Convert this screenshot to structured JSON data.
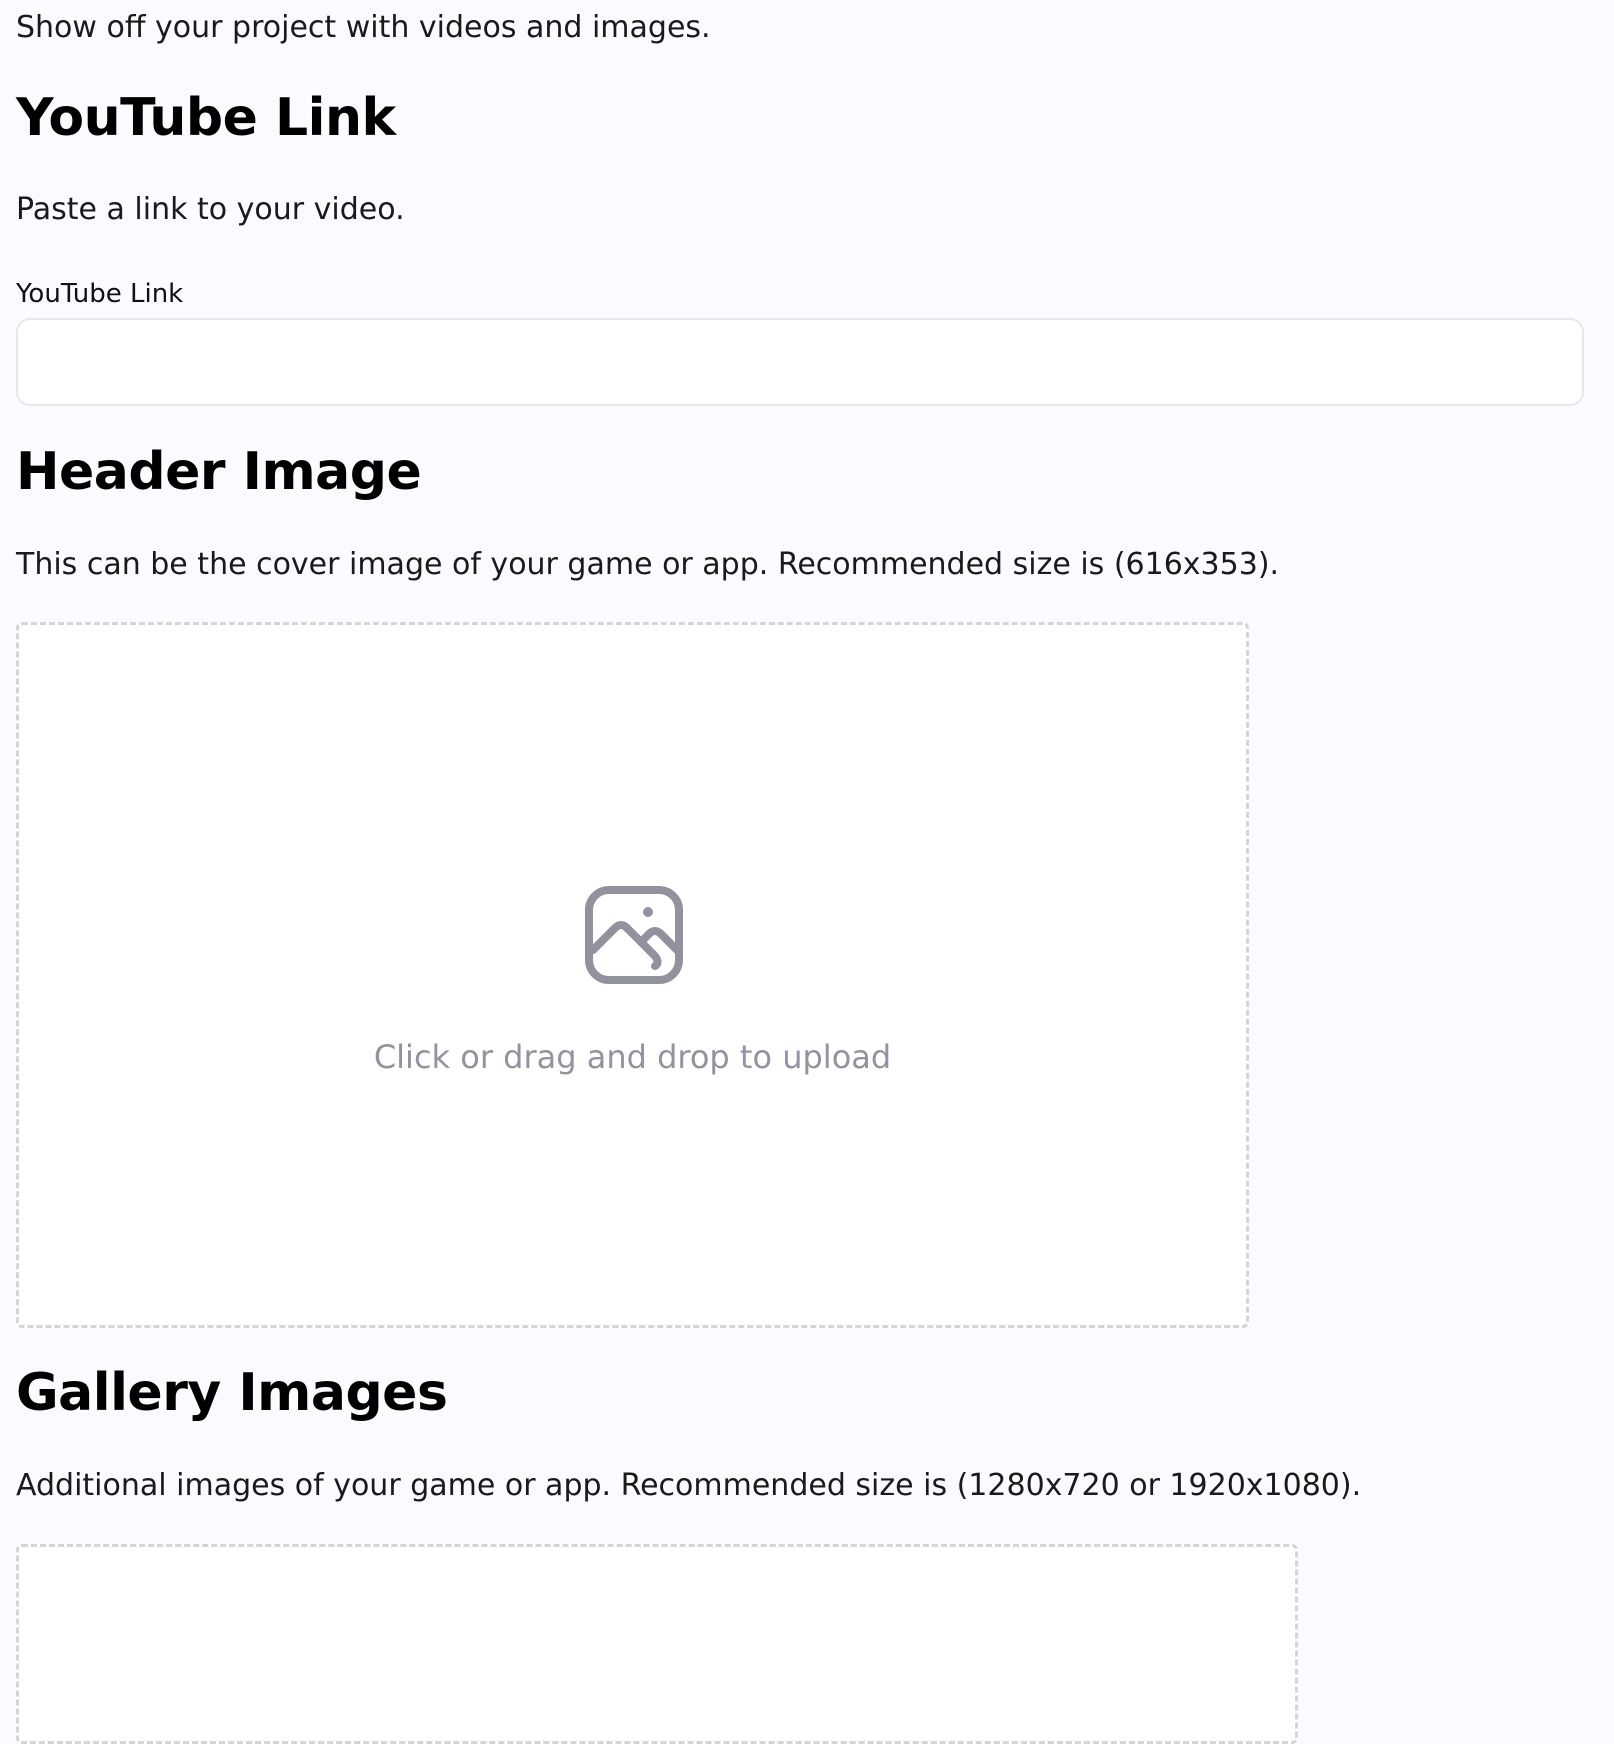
{
  "intro": {
    "text": "Show off your project with videos and images."
  },
  "youtube": {
    "title": "YouTube Link",
    "description": "Paste a link to your video.",
    "field_label": "YouTube Link",
    "value": "",
    "placeholder": ""
  },
  "header_image": {
    "title": "Header Image",
    "description": "This can be the cover image of your game or app. Recommended size is (616x353).",
    "upload_icon": "image-icon",
    "upload_text": "Click or drag and drop to upload"
  },
  "gallery": {
    "title": "Gallery Images",
    "description": "Additional images of your game or app. Recommended size is (1280x720 or 1920x1080)."
  },
  "colors": {
    "background": "#fafaff",
    "input_border": "#e6e6ec",
    "dropzone_border": "#d4d4da",
    "muted_text": "#9292a0"
  }
}
